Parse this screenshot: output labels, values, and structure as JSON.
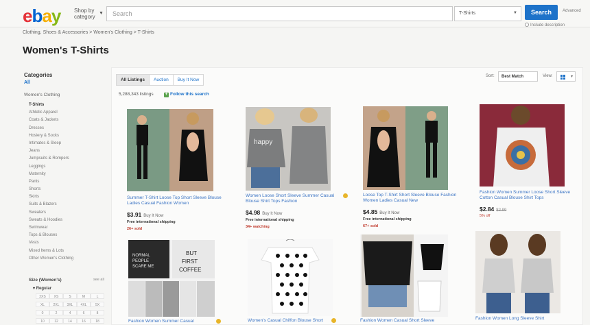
{
  "header": {
    "logo": [
      "e",
      "b",
      "a",
      "y"
    ],
    "logo_colors": [
      "#e53238",
      "#0064d2",
      "#f5af02",
      "#86b817"
    ],
    "shop_by": "Shop by category",
    "search_placeholder": "Search",
    "category_select": "T-Shirts",
    "search_button": "Search",
    "advanced": "Advanced",
    "include_description": "Include description"
  },
  "breadcrumb": "Clothing, Shoes & Accessories  >  Women's Clothing  >  T-Shirts",
  "page_title": "Women's T-Shirts",
  "sidebar": {
    "heading": "Categories",
    "all": "All",
    "parent": "Women's Clothing",
    "items": [
      "T-Shirts",
      "Athletic Apparel",
      "Coats & Jackets",
      "Dresses",
      "Hosiery & Socks",
      "Intimates & Sleep",
      "Jeans",
      "Jumpsuits & Rompers",
      "Leggings",
      "Maternity",
      "Pants",
      "Shorts",
      "Skirts",
      "Suits & Blazers",
      "Sweaters",
      "Sweats & Hoodies",
      "Swimwear",
      "Tops & Blouses",
      "Vests",
      "Mixed Items & Lots",
      "Other Women's Clothing"
    ],
    "size_heading": "Size (Women's)",
    "size_see_all": "see all",
    "size_regular": "Regular",
    "sizes": [
      "2XS",
      "XS",
      "S",
      "M",
      "L",
      "XL",
      "2XL",
      "3XL",
      "4XL",
      "5X",
      "0",
      "2",
      "4",
      "6",
      "8",
      "10",
      "12",
      "14",
      "16",
      "18"
    ]
  },
  "toolbar": {
    "tabs": [
      "All Listings",
      "Auction",
      "Buy It Now"
    ],
    "listing_count": "5,288,343 listings",
    "follow": "Follow this search",
    "sort_label": "Sort:",
    "sort_value": "Best Match",
    "view_label": "View:"
  },
  "products": [
    {
      "title": "Summer T-Shirt Loose Top Short Sleeve Blouse Ladies Casual Fashion Women",
      "price": "$3.91",
      "buy": "Buy It Now",
      "shipping": "Free international shipping",
      "sold": "26+ sold"
    },
    {
      "title": "Women Loose Short Sleeve Summer Casual Blouse Shirt Tops Fashion",
      "price": "$4.98",
      "buy": "Buy It Now",
      "shipping": "Free international shipping",
      "sold": "34+ watching"
    },
    {
      "title": "Loose Top T-Shirt Short Sleeve Blouse Fashion Women Ladies Casual New",
      "price": "$4.85",
      "buy": "Buy It Now",
      "shipping": "Free international shipping",
      "sold": "67+ sold"
    },
    {
      "title": "Fashion Women Summer Loose Short Sleeve Cotton Casual Blouse Shirt Tops",
      "price": "$2.84",
      "was": "$2.99",
      "pct": "5% off"
    },
    {
      "title": "Fashion Women Summer Casual"
    },
    {
      "title": "Women's Casual Chiffon Blouse Short"
    },
    {
      "title": "Fashion Women Casual Short Sleeve"
    },
    {
      "title": "Fashion Women Long Sleeve Shirt"
    }
  ],
  "colors": {
    "accent": "#1d72c9",
    "link": "#3b74c4",
    "sold": "#c0392b",
    "follow_plus": "#5ba34e"
  }
}
